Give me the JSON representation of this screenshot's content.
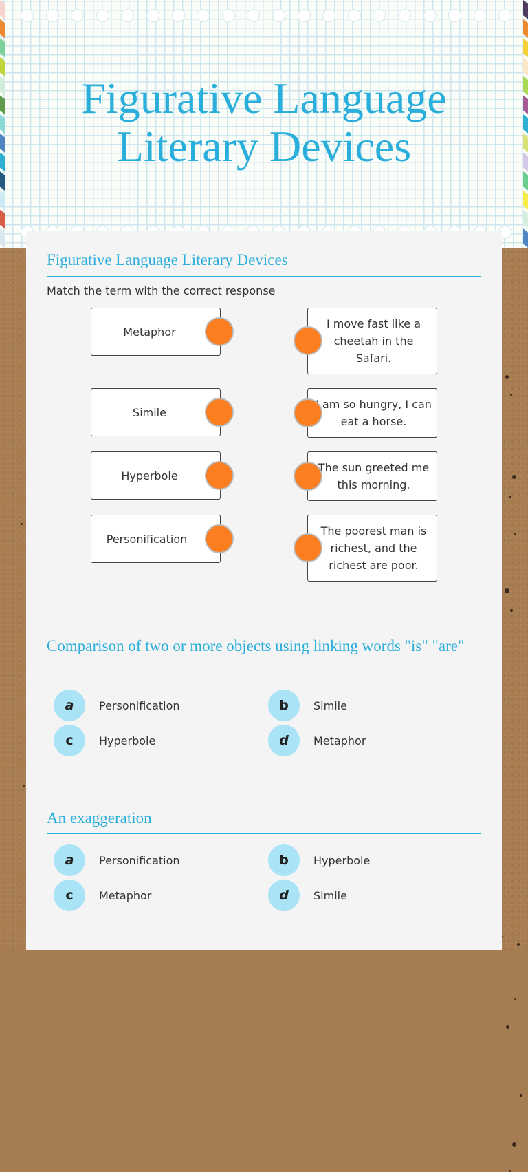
{
  "header": {
    "title_line1": "Figurative Language",
    "title_line2": "Literary Devices",
    "accent_color": "#2aaedb",
    "left_stripe_colors": [
      "#f6d3cd",
      "#ec8b30",
      "#7ed19a",
      "#bfd63a",
      "#d2eedb",
      "#5e9a4a",
      "#8ad9d6",
      "#4f86c1",
      "#2eaed3",
      "#255a80",
      "#cde9f2",
      "#d75d45",
      "#dbe7ef"
    ],
    "right_stripe_colors": [
      "#4e3b5e",
      "#ec8b30",
      "#f4d03a",
      "#fbe6c8",
      "#a9d957",
      "#a55b95",
      "#2eaed3",
      "#d9e274",
      "#d3c8e8",
      "#6bcc8f",
      "#f7eb4a",
      "#d5eedf",
      "#4f86c1"
    ]
  },
  "worksheet": {
    "questions": [
      {
        "type": "matching",
        "title": "Figurative Language Literary Devices",
        "instruction": "Match the term with the correct response",
        "terms": [
          "Metaphor",
          "Simile",
          "Hyperbole",
          "Personification"
        ],
        "responses": [
          "I move fast like a cheetah in the Safari.",
          "I am so hungry, I can eat a horse.",
          "The sun greeted me this morning.",
          "The poorest man is richest, and the richest are poor."
        ],
        "dot_color": "#fd7e1f"
      },
      {
        "type": "multiple-choice",
        "title": "Comparison of two or more objects using linking words \"is\" \"are\"",
        "options": [
          {
            "letter": "a",
            "label": "Personification"
          },
          {
            "letter": "b",
            "label": "Simile"
          },
          {
            "letter": "c",
            "label": "Hyperbole"
          },
          {
            "letter": "d",
            "label": "Metaphor"
          }
        ]
      },
      {
        "type": "multiple-choice",
        "title": "An exaggeration",
        "options": [
          {
            "letter": "a",
            "label": "Personification"
          },
          {
            "letter": "b",
            "label": "Hyperbole"
          },
          {
            "letter": "c",
            "label": "Metaphor"
          },
          {
            "letter": "d",
            "label": "Simile"
          }
        ]
      }
    ],
    "badge_color": "#abe3f6"
  }
}
